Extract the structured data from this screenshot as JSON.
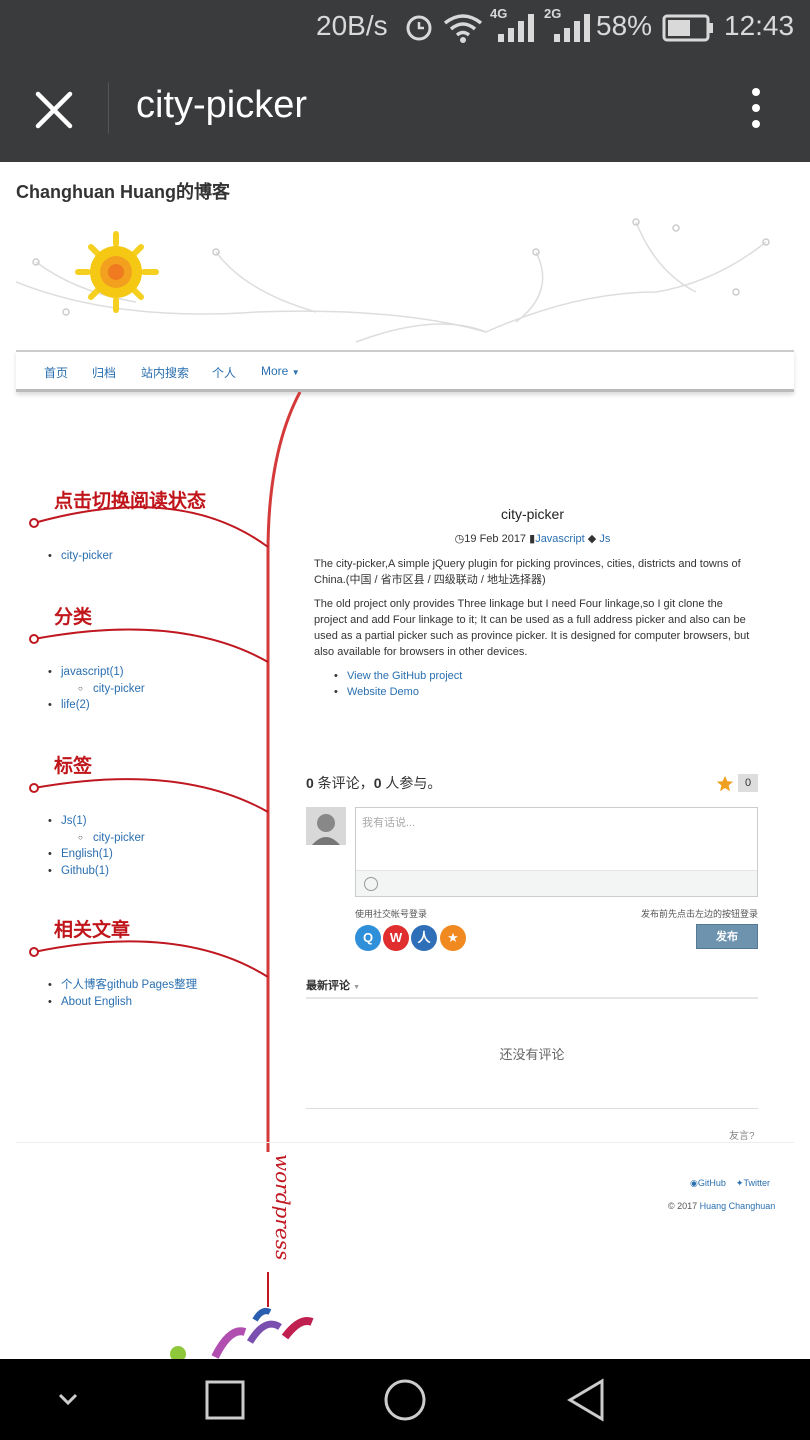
{
  "status_bar": {
    "speed": "20B/s",
    "network_1": "4G",
    "network_2": "2G",
    "battery": "58%",
    "time": "12:43"
  },
  "title_bar": {
    "title": "city-picker"
  },
  "blog": {
    "title": "Changhuan Huang的博客"
  },
  "nav": {
    "items": [
      "首页",
      "归档",
      "站内搜索",
      "个人",
      "More"
    ]
  },
  "sidebar": {
    "sections": [
      {
        "heading": "点击切换阅读状态",
        "items": [
          "city-picker"
        ]
      },
      {
        "heading": "分类",
        "items": [
          "javascript(1)",
          "city-picker",
          "life(2)"
        ]
      },
      {
        "heading": "标签",
        "items": [
          "Js(1)",
          "city-picker",
          "English(1)",
          "Github(1)"
        ]
      },
      {
        "heading": "相关文章",
        "items": [
          "个人博客github Pages整理",
          "About English"
        ]
      }
    ],
    "thread_text": "wordpress"
  },
  "post": {
    "title": "city-picker",
    "date": "19 Feb 2017",
    "category": "Javascript",
    "tag": "Js",
    "para1": "The city-picker,A simple jQuery plugin for picking provinces, cities, districts and towns of China.(中国 / 省市区县 / 四级联动 / 地址选择器)",
    "para2": "The old project only provides Three linkage but I need Four linkage,so I git clone the project and add Four linkage to it; It can be used as a full address picker and also can be used as a partial picker such as province picker. It is designed for computer browsers, but also available for browsers in other devices.",
    "links": [
      "View the GitHub project",
      "Website Demo"
    ]
  },
  "comments": {
    "count_num": "0",
    "count_mid": " 条评论，",
    "people_num": "0",
    "count_tail": " 人参与。",
    "star_count": "0",
    "placeholder": "我有话说...",
    "login_label": "使用社交帐号登录",
    "login_hint": "发布前先点击左边的按钮登录",
    "publish": "发布",
    "latest": "最新评论",
    "empty": "还没有评论",
    "powered": "友言?"
  },
  "footer": {
    "github": "GitHub",
    "twitter": "Twitter",
    "copyright_prefix": "© 2017 ",
    "copyright_name": "Huang Changhuan"
  },
  "colors": {
    "accent_red": "#c0161b",
    "link_blue": "#2a6fb0",
    "bar_dark": "#3a3b3d"
  },
  "icons": [
    "alarm-icon",
    "wifi-icon",
    "signal-icon",
    "battery-icon",
    "close-icon",
    "more-vert-icon",
    "clock-icon",
    "book-icon",
    "tags-icon",
    "star-icon",
    "emoji-icon",
    "qq-icon",
    "weibo-icon",
    "renren-icon",
    "douban-icon",
    "github-icon",
    "twitter-icon",
    "back-icon",
    "home-icon",
    "recents-icon",
    "down-icon"
  ]
}
